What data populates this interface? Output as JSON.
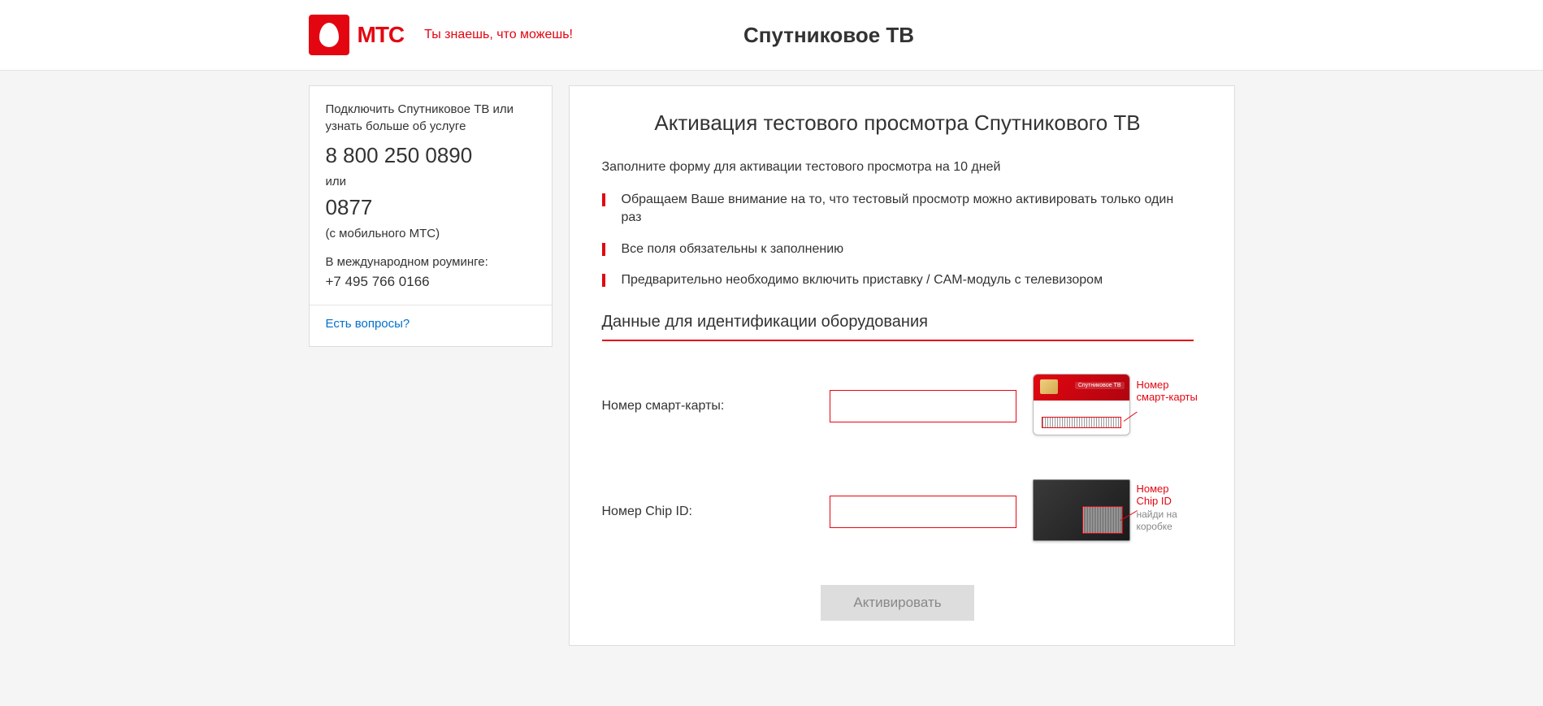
{
  "header": {
    "logo_text": "МТС",
    "tagline": "Ты знаешь, что можешь!",
    "page_title": "Спутниковое ТВ"
  },
  "sidebar": {
    "intro": "Подключить Спутниковое ТВ или узнать больше об услуге",
    "phone1": "8 800 250 0890",
    "or": "или",
    "phone2": "0877",
    "phone2_note": "(с мобильного МТС)",
    "roaming_label": "В международном роуминге:",
    "roaming_phone": "+7 495 766 0166",
    "questions_link": "Есть вопросы?"
  },
  "main": {
    "title": "Активация тестового просмотра Спутникового ТВ",
    "intro": "Заполните форму для активации тестового просмотра на 10 дней",
    "bullets": [
      "Обращаем Ваше внимание на то, что тестовый просмотр можно активировать только один раз",
      "Все поля обязательны к заполнению",
      "Предварительно необходимо включить приставку / CAM-модуль с телевизором"
    ],
    "section_heading": "Данные для идентификации оборудования",
    "fields": {
      "smartcard_label": "Номер смарт-карты:",
      "smartcard_value": "",
      "chipid_label": "Номер Chip ID:",
      "chipid_value": ""
    },
    "callouts": {
      "smartcard_line1": "Номер",
      "smartcard_line2": "смарт-карты",
      "chipid_line1": "Номер",
      "chipid_line2": "Chip ID",
      "chipid_line3": "найди на",
      "chipid_line4": "коробке",
      "card_brand": "Спутниковое ТВ"
    },
    "submit_label": "Активировать"
  }
}
